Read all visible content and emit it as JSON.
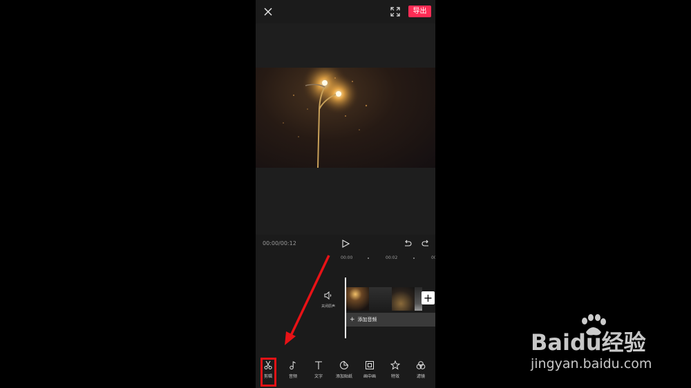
{
  "topbar": {
    "close_icon": "close-icon",
    "fullscreen_icon": "fullscreen-icon",
    "export_label": "导出",
    "accent_color": "#fe2c55"
  },
  "player": {
    "time": "00:00/00:12",
    "play_icon": "play-icon",
    "undo_icon": "undo-icon",
    "redo_icon": "redo-icon"
  },
  "timeline": {
    "ruler": [
      "00:00",
      "00:02",
      "00"
    ],
    "mute_label": "关闭原声",
    "add_clip_label": "+",
    "add_audio_plus": "+",
    "add_audio_label": "添加音频"
  },
  "toolbar": {
    "items": [
      {
        "label": "剪辑",
        "icon": "scissors-icon"
      },
      {
        "label": "音频",
        "icon": "music-note-icon"
      },
      {
        "label": "文字",
        "icon": "text-icon"
      },
      {
        "label": "添加贴纸",
        "icon": "sticker-icon"
      },
      {
        "label": "画中画",
        "icon": "picture-in-picture-icon"
      },
      {
        "label": "特效",
        "icon": "effects-star-icon"
      },
      {
        "label": "滤镜",
        "icon": "filter-icon"
      }
    ]
  },
  "annotation": {
    "highlight_color": "#e81216"
  },
  "watermark": {
    "logo_text": "Baidu经验",
    "url": "jingyan.baidu.com"
  }
}
